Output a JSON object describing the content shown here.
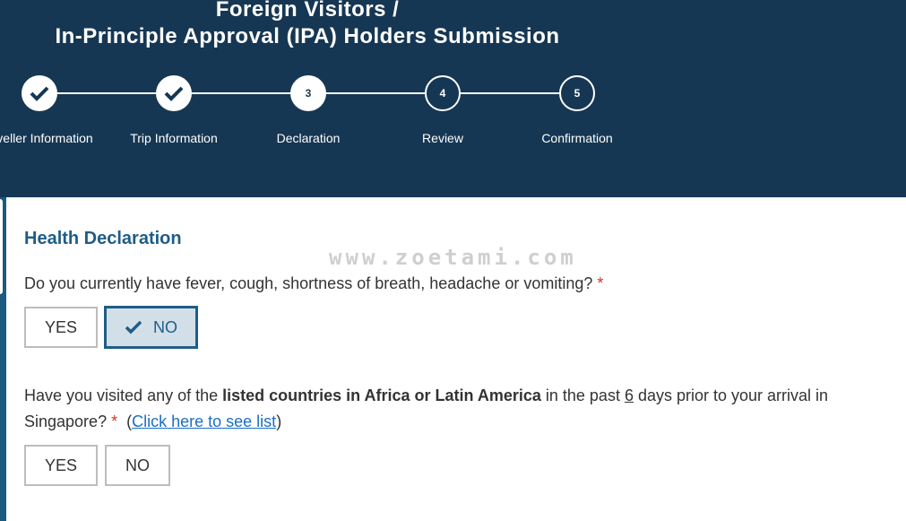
{
  "header": {
    "title_line1": "Foreign Visitors /",
    "title_line2": "In-Principle Approval (IPA) Holders Submission"
  },
  "stepper": {
    "current_step": 3,
    "steps": [
      {
        "number": "1",
        "label": "Traveller Information",
        "visible_label": "veller Information",
        "status": "completed",
        "icon": "check-icon"
      },
      {
        "number": "2",
        "label": "Trip Information",
        "visible_label": "Trip Information",
        "status": "completed",
        "icon": "check-icon"
      },
      {
        "number": "3",
        "label": "Declaration",
        "visible_label": "Declaration",
        "status": "active"
      },
      {
        "number": "4",
        "label": "Review",
        "visible_label": "Review",
        "status": "pending"
      },
      {
        "number": "5",
        "label": "Confirmation",
        "visible_label": "Confirmation",
        "status": "pending"
      }
    ]
  },
  "section": {
    "title": "Health Declaration"
  },
  "watermark": "www.zoetami.com",
  "questions": [
    {
      "text": "Do you currently have fever, cough, shortness of breath, headache or vomiting?",
      "required_marker": "*",
      "options": [
        {
          "label": "YES",
          "selected": false
        },
        {
          "label": "NO",
          "selected": true,
          "icon": "check-icon"
        }
      ]
    },
    {
      "text_part1": "Have you visited any of the ",
      "text_bold": "listed countries in Africa or Latin America",
      "text_part2": " in the past ",
      "days": "6",
      "text_part3": " days prior to your arrival in Singapore?",
      "required_marker": "*",
      "link_open": "(",
      "link_text": "Click here to see list",
      "link_close": ")",
      "options": [
        {
          "label": "YES",
          "selected": false
        },
        {
          "label": "NO",
          "selected": false
        }
      ]
    }
  ],
  "colors": {
    "header_bg": "#163753",
    "accent": "#1f5d85",
    "selected_bg": "#d3dfe8",
    "required": "#d9302c",
    "link": "#1a6fc4"
  }
}
